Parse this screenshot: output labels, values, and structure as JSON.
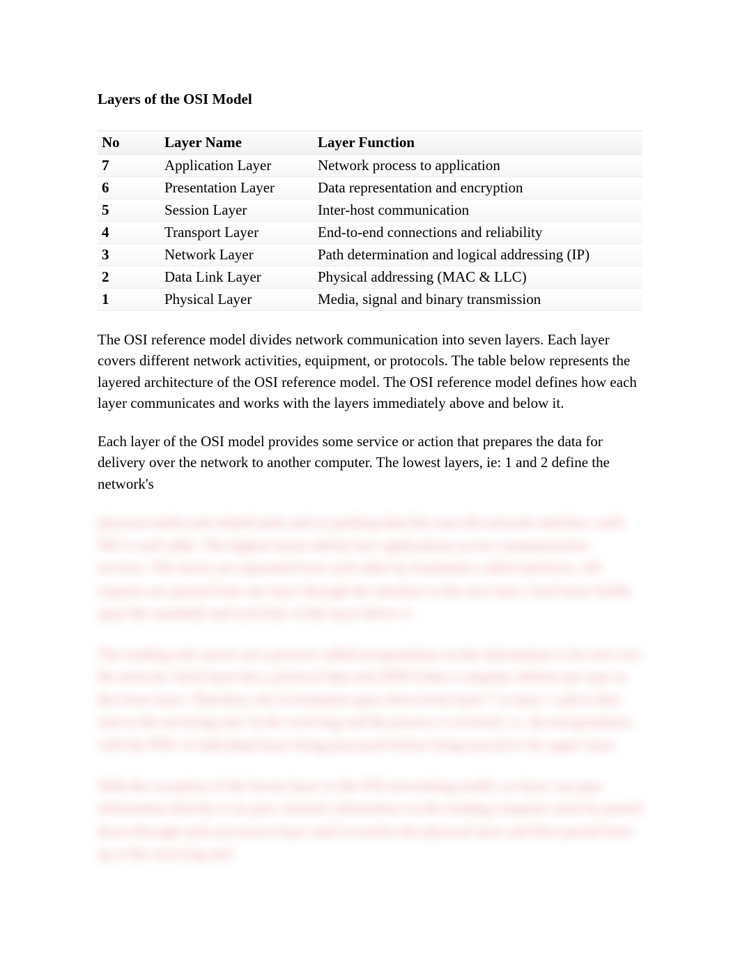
{
  "title": "Layers of the OSI Model",
  "table": {
    "headers": {
      "no": "No",
      "name": "Layer Name",
      "func": "Layer Function"
    },
    "rows": [
      {
        "no": "7",
        "name": "Application Layer",
        "func": "Network process to application"
      },
      {
        "no": "6",
        "name": "Presentation Layer",
        "func": "Data representation and encryption"
      },
      {
        "no": "5",
        "name": "Session Layer",
        "func": "Inter-host communication"
      },
      {
        "no": "4",
        "name": "Transport Layer",
        "func": "End-to-end connections and reliability"
      },
      {
        "no": "3",
        "name": "Network Layer",
        "func": "Path determination and logical addressing (IP)"
      },
      {
        "no": "2",
        "name": "Data Link Layer",
        "func": "Physical addressing (MAC & LLC)"
      },
      {
        "no": "1",
        "name": "Physical Layer",
        "func": "Media, signal and binary transmission"
      }
    ]
  },
  "paragraphs": [
    "The OSI reference model divides network communication into seven layers. Each layer covers different network activities, equipment, or protocols. The table below represents the layered architecture of the OSI reference model. The OSI reference model defines how each layer communicates and works with the layers immediately above and below it.",
    "Each layer of the OSI model provides some service or action that prepares the data for delivery over the network to another computer. The lowest layers, ie: 1 and 2 define the network's"
  ],
  "blurred": [
    "physical media and related tasks and so pushing data bits onto the network interface card's NIC's cord cable. The highest layers define how applications access communication services. The layers are separated from each other by boundaries called interfaces. All requests are passed from one layer through the interface to the next layer. Each layer builds upon the standards and activities of the layer below it.",
    "The sending end carries out a process called encapsulation on the information to be sent over the network. Each layer has a protocol data unit (PDU) that a computer defines per type as the lower layer. Therefore, the in-formation goes down from layer 7 to layer 1 and is then sent to the receiving end. At the receiving end the process is reversed, i.e. de-encapsulation, with the PDU of individual layer being processed before being moved to the upper layer.",
    "With the exception of the lowest layer in the OSI networking model, no layer can pass information directly to its peer. Instead, information on the sending computer must be passed down through each successive layer until it reaches the physical layer and then passed back up at the receiving end."
  ]
}
